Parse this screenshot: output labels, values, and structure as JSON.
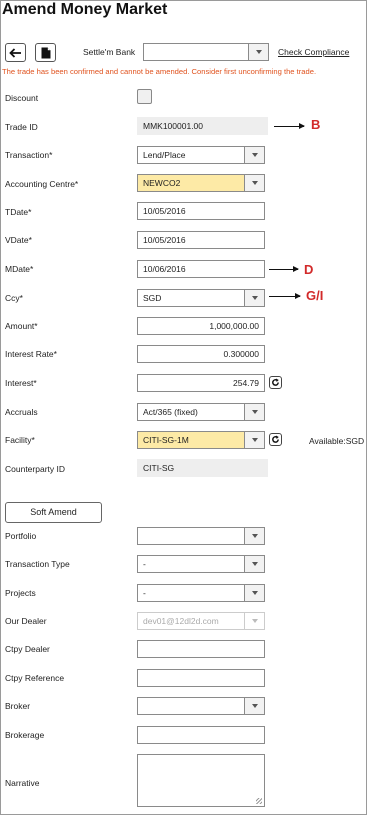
{
  "title": "Amend Money Market",
  "toolbar": {
    "settle_label": "Settle'm Bank",
    "settle_value": "",
    "check_compliance": "Check Compliance"
  },
  "warning": "The trade has been confirmed and cannot be amended. Consider first unconfirming the trade.",
  "fields": {
    "discount": {
      "label": "Discount"
    },
    "trade_id": {
      "label": "Trade ID",
      "value": "MMK100001.00"
    },
    "transaction": {
      "label": "Transaction*",
      "value": "Lend/Place"
    },
    "accounting_centre": {
      "label": "Accounting Centre*",
      "value": "NEWCO2"
    },
    "tdate": {
      "label": "TDate*",
      "value": "10/05/2016"
    },
    "vdate": {
      "label": "VDate*",
      "value": "10/05/2016"
    },
    "mdate": {
      "label": "MDate*",
      "value": "10/06/2016"
    },
    "ccy": {
      "label": "Ccy*",
      "value": "SGD"
    },
    "amount": {
      "label": "Amount*",
      "value": "1,000,000.00"
    },
    "interest_rate": {
      "label": "Interest Rate*",
      "value": "0.300000"
    },
    "interest": {
      "label": "Interest*",
      "value": "254.79"
    },
    "accruals": {
      "label": "Accruals",
      "value": "Act/365 (fixed)"
    },
    "facility": {
      "label": "Facility*",
      "value": "CITI-SG-1M",
      "available": "Available:SGD"
    },
    "counterparty_id": {
      "label": "Counterparty ID",
      "value": "CITI-SG"
    },
    "portfolio": {
      "label": "Portfolio",
      "value": ""
    },
    "transaction_type": {
      "label": "Transaction Type",
      "value": "-"
    },
    "projects": {
      "label": "Projects",
      "value": "-"
    },
    "our_dealer": {
      "label": "Our Dealer",
      "value": "dev01@12dl2d.com"
    },
    "ctpy_dealer": {
      "label": "Ctpy Dealer",
      "value": ""
    },
    "ctpy_reference": {
      "label": "Ctpy Reference",
      "value": ""
    },
    "broker": {
      "label": "Broker",
      "value": ""
    },
    "brokerage": {
      "label": "Brokerage",
      "value": ""
    },
    "narrative": {
      "label": "Narrative",
      "value": ""
    }
  },
  "soft_amend": "Soft Amend",
  "annotations": {
    "b": "B",
    "d": "D",
    "gi": "G/I"
  },
  "colors": {
    "warning": "#e0531f",
    "highlight": "#fdeaa6",
    "annotation": "#d22a2a"
  }
}
